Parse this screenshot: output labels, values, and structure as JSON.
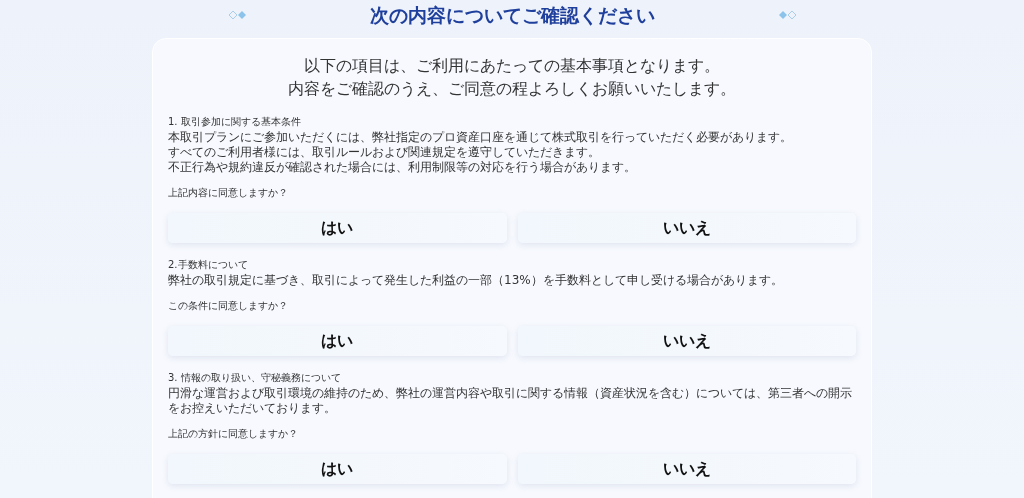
{
  "title": "次の内容についてご確認ください",
  "intro": [
    "以下の項目は、ご利用にあたっての基本事項となります。",
    "内容をご確認のうえ、ご同意の程よろしくお願いいたします。"
  ],
  "sections": [
    {
      "heading": "1.  取引参加に関する基本条件",
      "lines": [
        "本取引プランにご参加いただくには、弊社指定のプロ資産口座を通じて株式取引を行っていただく必要があります。",
        "すべてのご利用者様には、取引ルールおよび関連規定を遵守していただきます。",
        "不正行為や規約違反が確認された場合には、利用制限等の対応を行う場合があります。"
      ],
      "question": "上記内容に同意しますか？",
      "buttons": [
        "はい",
        "いいえ"
      ]
    },
    {
      "heading": "2.手数料について",
      "lines": [
        "弊社の取引規定に基づき、取引によって発生した利益の一部（13%）を手数料として申し受ける場合があります。"
      ],
      "question": "この条件に同意しますか？",
      "buttons": [
        "はい",
        "いいえ"
      ]
    },
    {
      "heading": "3.  情報の取り扱い、守秘義務について",
      "lines": [
        "円滑な運営および取引環境の維持のため、弊社の運営内容や取引に関する情報（資産状況を含む）については、第三者への開示をお控えいただいております。"
      ],
      "question": "上記の方針に同意しますか？",
      "buttons": [
        "はい",
        "いいえ"
      ]
    }
  ]
}
